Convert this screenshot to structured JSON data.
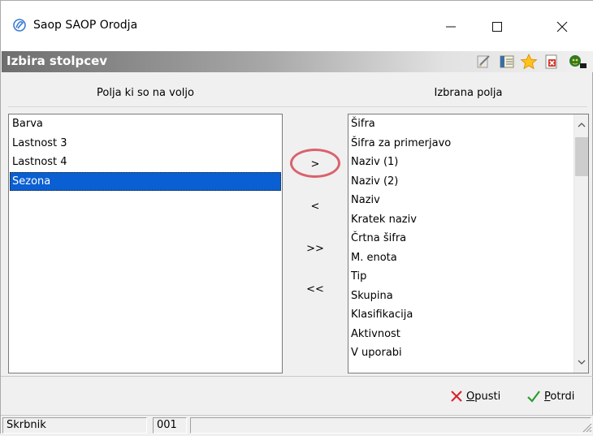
{
  "window": {
    "title": "Saop SAOP Orodja",
    "minimize_glyph": "—",
    "maximize_glyph": "☐",
    "close_glyph": "✕"
  },
  "header": {
    "title": "Izbira stolpcev",
    "toolbar_icons": [
      "edit-icon",
      "columns-icon",
      "favorite-star-icon",
      "close-document-icon",
      "help-person-icon"
    ]
  },
  "left_panel": {
    "heading": "Polja ki so na voljo",
    "items": [
      "Barva",
      "Lastnost 3",
      "Lastnost 4",
      "Sezona"
    ],
    "selected_index": 3
  },
  "right_panel": {
    "heading": "Izbrana polja",
    "items": [
      "Šifra",
      "Šifra za primerjavo",
      "Naziv (1)",
      "Naziv (2)",
      "Naziv",
      "Kratek naziv",
      "Črtna šifra",
      "M. enota",
      "Tip",
      "Skupina",
      "Klasifikacija",
      "Aktivnost",
      "V uporabi"
    ]
  },
  "transfer_buttons": {
    "add_one": ">",
    "remove_one": "<",
    "add_all": ">>",
    "remove_all": "<<"
  },
  "actions": {
    "cancel_label": "Opusti",
    "cancel_accel": "O",
    "cancel_rest": "pusti",
    "confirm_label": "Potrdi",
    "confirm_accel": "P",
    "confirm_rest": "otrdi"
  },
  "status_bar": {
    "user": "Skrbnik",
    "code": "001"
  },
  "colors": {
    "selection": "#0a5fd2",
    "highlight_ring": "#d9626e",
    "cancel_x": "#d8202a",
    "confirm_check": "#2e9b2e"
  }
}
